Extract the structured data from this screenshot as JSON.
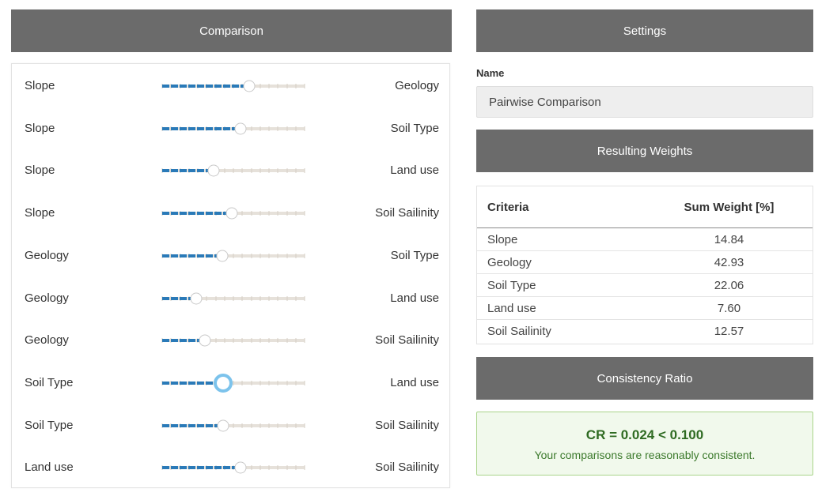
{
  "comparison": {
    "header": "Comparison",
    "rows": [
      {
        "left": "Slope",
        "right": "Geology",
        "value": 0.61
      },
      {
        "left": "Slope",
        "right": "Soil Type",
        "value": 0.55
      },
      {
        "left": "Slope",
        "right": "Land use",
        "value": 0.36
      },
      {
        "left": "Slope",
        "right": "Soil Sailinity",
        "value": 0.49
      },
      {
        "left": "Geology",
        "right": "Soil Type",
        "value": 0.42
      },
      {
        "left": "Geology",
        "right": "Land use",
        "value": 0.24
      },
      {
        "left": "Geology",
        "right": "Soil Sailinity",
        "value": 0.3
      },
      {
        "left": "Soil Type",
        "right": "Land use",
        "value": 0.43
      },
      {
        "left": "Soil Type",
        "right": "Soil Sailinity",
        "value": 0.43
      },
      {
        "left": "Land use",
        "right": "Soil Sailinity",
        "value": 0.55
      }
    ],
    "active_row": 7
  },
  "settings": {
    "header": "Settings",
    "name_label": "Name",
    "name_value": "Pairwise Comparison"
  },
  "weights": {
    "header": "Resulting Weights",
    "columns": [
      "Criteria",
      "Sum Weight [%]"
    ],
    "rows": [
      {
        "criteria": "Slope",
        "weight": "14.84"
      },
      {
        "criteria": "Geology",
        "weight": "42.93"
      },
      {
        "criteria": "Soil Type",
        "weight": "22.06"
      },
      {
        "criteria": "Land use",
        "weight": "7.60"
      },
      {
        "criteria": "Soil Sailinity",
        "weight": "12.57"
      }
    ]
  },
  "consistency": {
    "header": "Consistency Ratio",
    "value": "CR = 0.024 < 0.100",
    "message": "Your comparisons are reasonably consistent."
  },
  "colors": {
    "header_bg": "#6b6b6b",
    "slider_fill": "#2a7ab8",
    "slider_track": "#e6e1da",
    "active_handle": "#7cc3ec",
    "cr_text": "#2f6b22"
  }
}
